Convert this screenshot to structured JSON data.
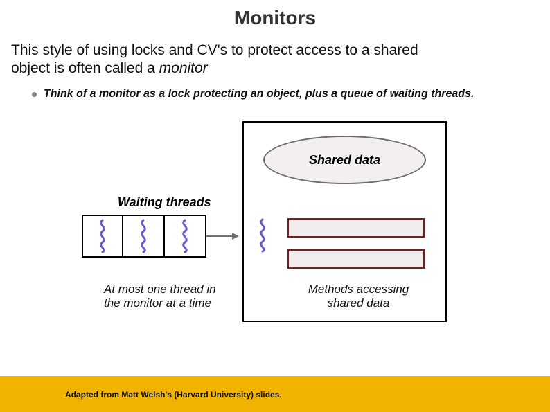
{
  "title": "Monitors",
  "body": {
    "line1": "This style of using locks and CV's to protect access to a shared",
    "line2_a": "object is often called a ",
    "line2_b": "monitor"
  },
  "bullet": "Think of a monitor as a lock protecting an object, plus a queue of waiting threads.",
  "diagram": {
    "shared_data_label": "Shared data",
    "waiting_label": "Waiting threads",
    "caption_left_l1": "At most one thread in",
    "caption_left_l2": "the monitor at a time",
    "caption_right_l1": "Methods accessing",
    "caption_right_l2": "shared data"
  },
  "footer": "Adapted from Matt Welsh's (Harvard University) slides.",
  "colors": {
    "accent": "#f0b400",
    "squiggle": "#6a5acd"
  }
}
